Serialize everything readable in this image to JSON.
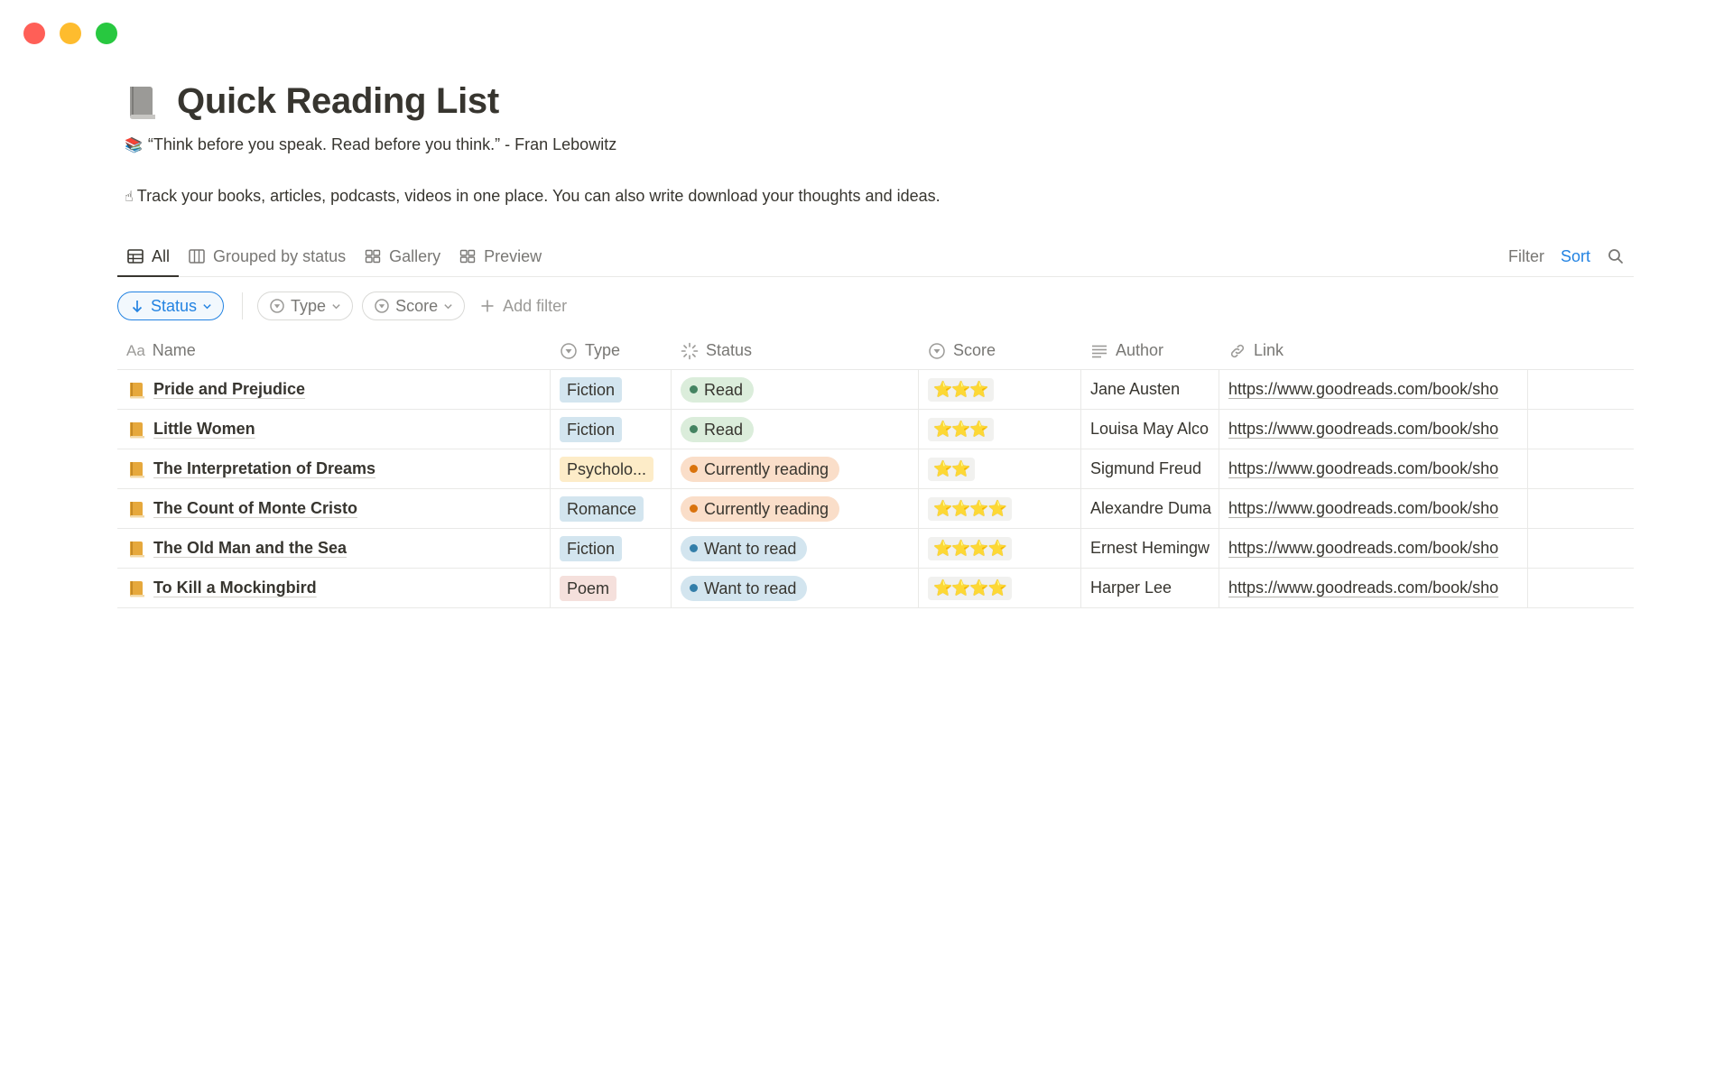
{
  "page": {
    "title": "Quick Reading List",
    "quote_emoji": "📚",
    "quote": "“Think before you speak. Read before you think.” - Fran Lebowitz",
    "desc_emoji": "☝",
    "description": "Track your books, articles, podcasts, videos in one place. You can also write download your thoughts and ideas."
  },
  "tabs": [
    {
      "label": "All",
      "active": true
    },
    {
      "label": "Grouped by status",
      "active": false
    },
    {
      "label": "Gallery",
      "active": false
    },
    {
      "label": "Preview",
      "active": false
    }
  ],
  "toolbar": {
    "filter": "Filter",
    "sort": "Sort"
  },
  "filters": {
    "status": "Status",
    "type": "Type",
    "score": "Score",
    "add": "Add filter"
  },
  "columns": {
    "name_prefix": "Aa",
    "name": "Name",
    "type": "Type",
    "status": "Status",
    "score": "Score",
    "author": "Author",
    "link": "Link"
  },
  "colors": {
    "type": {
      "Fiction": "#d3e5ef",
      "Psycholo...": "#fdecc8",
      "Romance": "#d3e5ef",
      "Poem": "#f5e0dc"
    },
    "status": {
      "Read": {
        "bg": "#dbeddb",
        "dot": "#448361"
      },
      "Currently reading": {
        "bg": "#fadec9",
        "dot": "#d9730d"
      },
      "Want to read": {
        "bg": "#d3e5ef",
        "dot": "#337ea9"
      }
    }
  },
  "rows": [
    {
      "name": "Pride and Prejudice",
      "type": "Fiction",
      "status": "Read",
      "score": "⭐⭐⭐",
      "author": "Jane Austen",
      "link": "https://www.goodreads.com/book/sho"
    },
    {
      "name": "Little Women",
      "type": "Fiction",
      "status": "Read",
      "score": "⭐⭐⭐",
      "author": "Louisa May Alco",
      "link": "https://www.goodreads.com/book/sho"
    },
    {
      "name": "The Interpretation of Dreams",
      "type": "Psycholo...",
      "status": "Currently reading",
      "score": "⭐⭐",
      "author": "Sigmund Freud",
      "link": "https://www.goodreads.com/book/sho"
    },
    {
      "name": "The Count of Monte Cristo",
      "type": "Romance",
      "status": "Currently reading",
      "score": "⭐⭐⭐⭐",
      "author": "Alexandre Duma",
      "link": "https://www.goodreads.com/book/sho"
    },
    {
      "name": "The Old Man and the Sea",
      "type": "Fiction",
      "status": "Want to read",
      "score": "⭐⭐⭐⭐",
      "author": "Ernest Hemingw",
      "link": "https://www.goodreads.com/book/sho"
    },
    {
      "name": "To Kill a Mockingbird",
      "type": "Poem",
      "status": "Want to read",
      "score": "⭐⭐⭐⭐",
      "author": "Harper Lee",
      "link": "https://www.goodreads.com/book/sho"
    }
  ]
}
